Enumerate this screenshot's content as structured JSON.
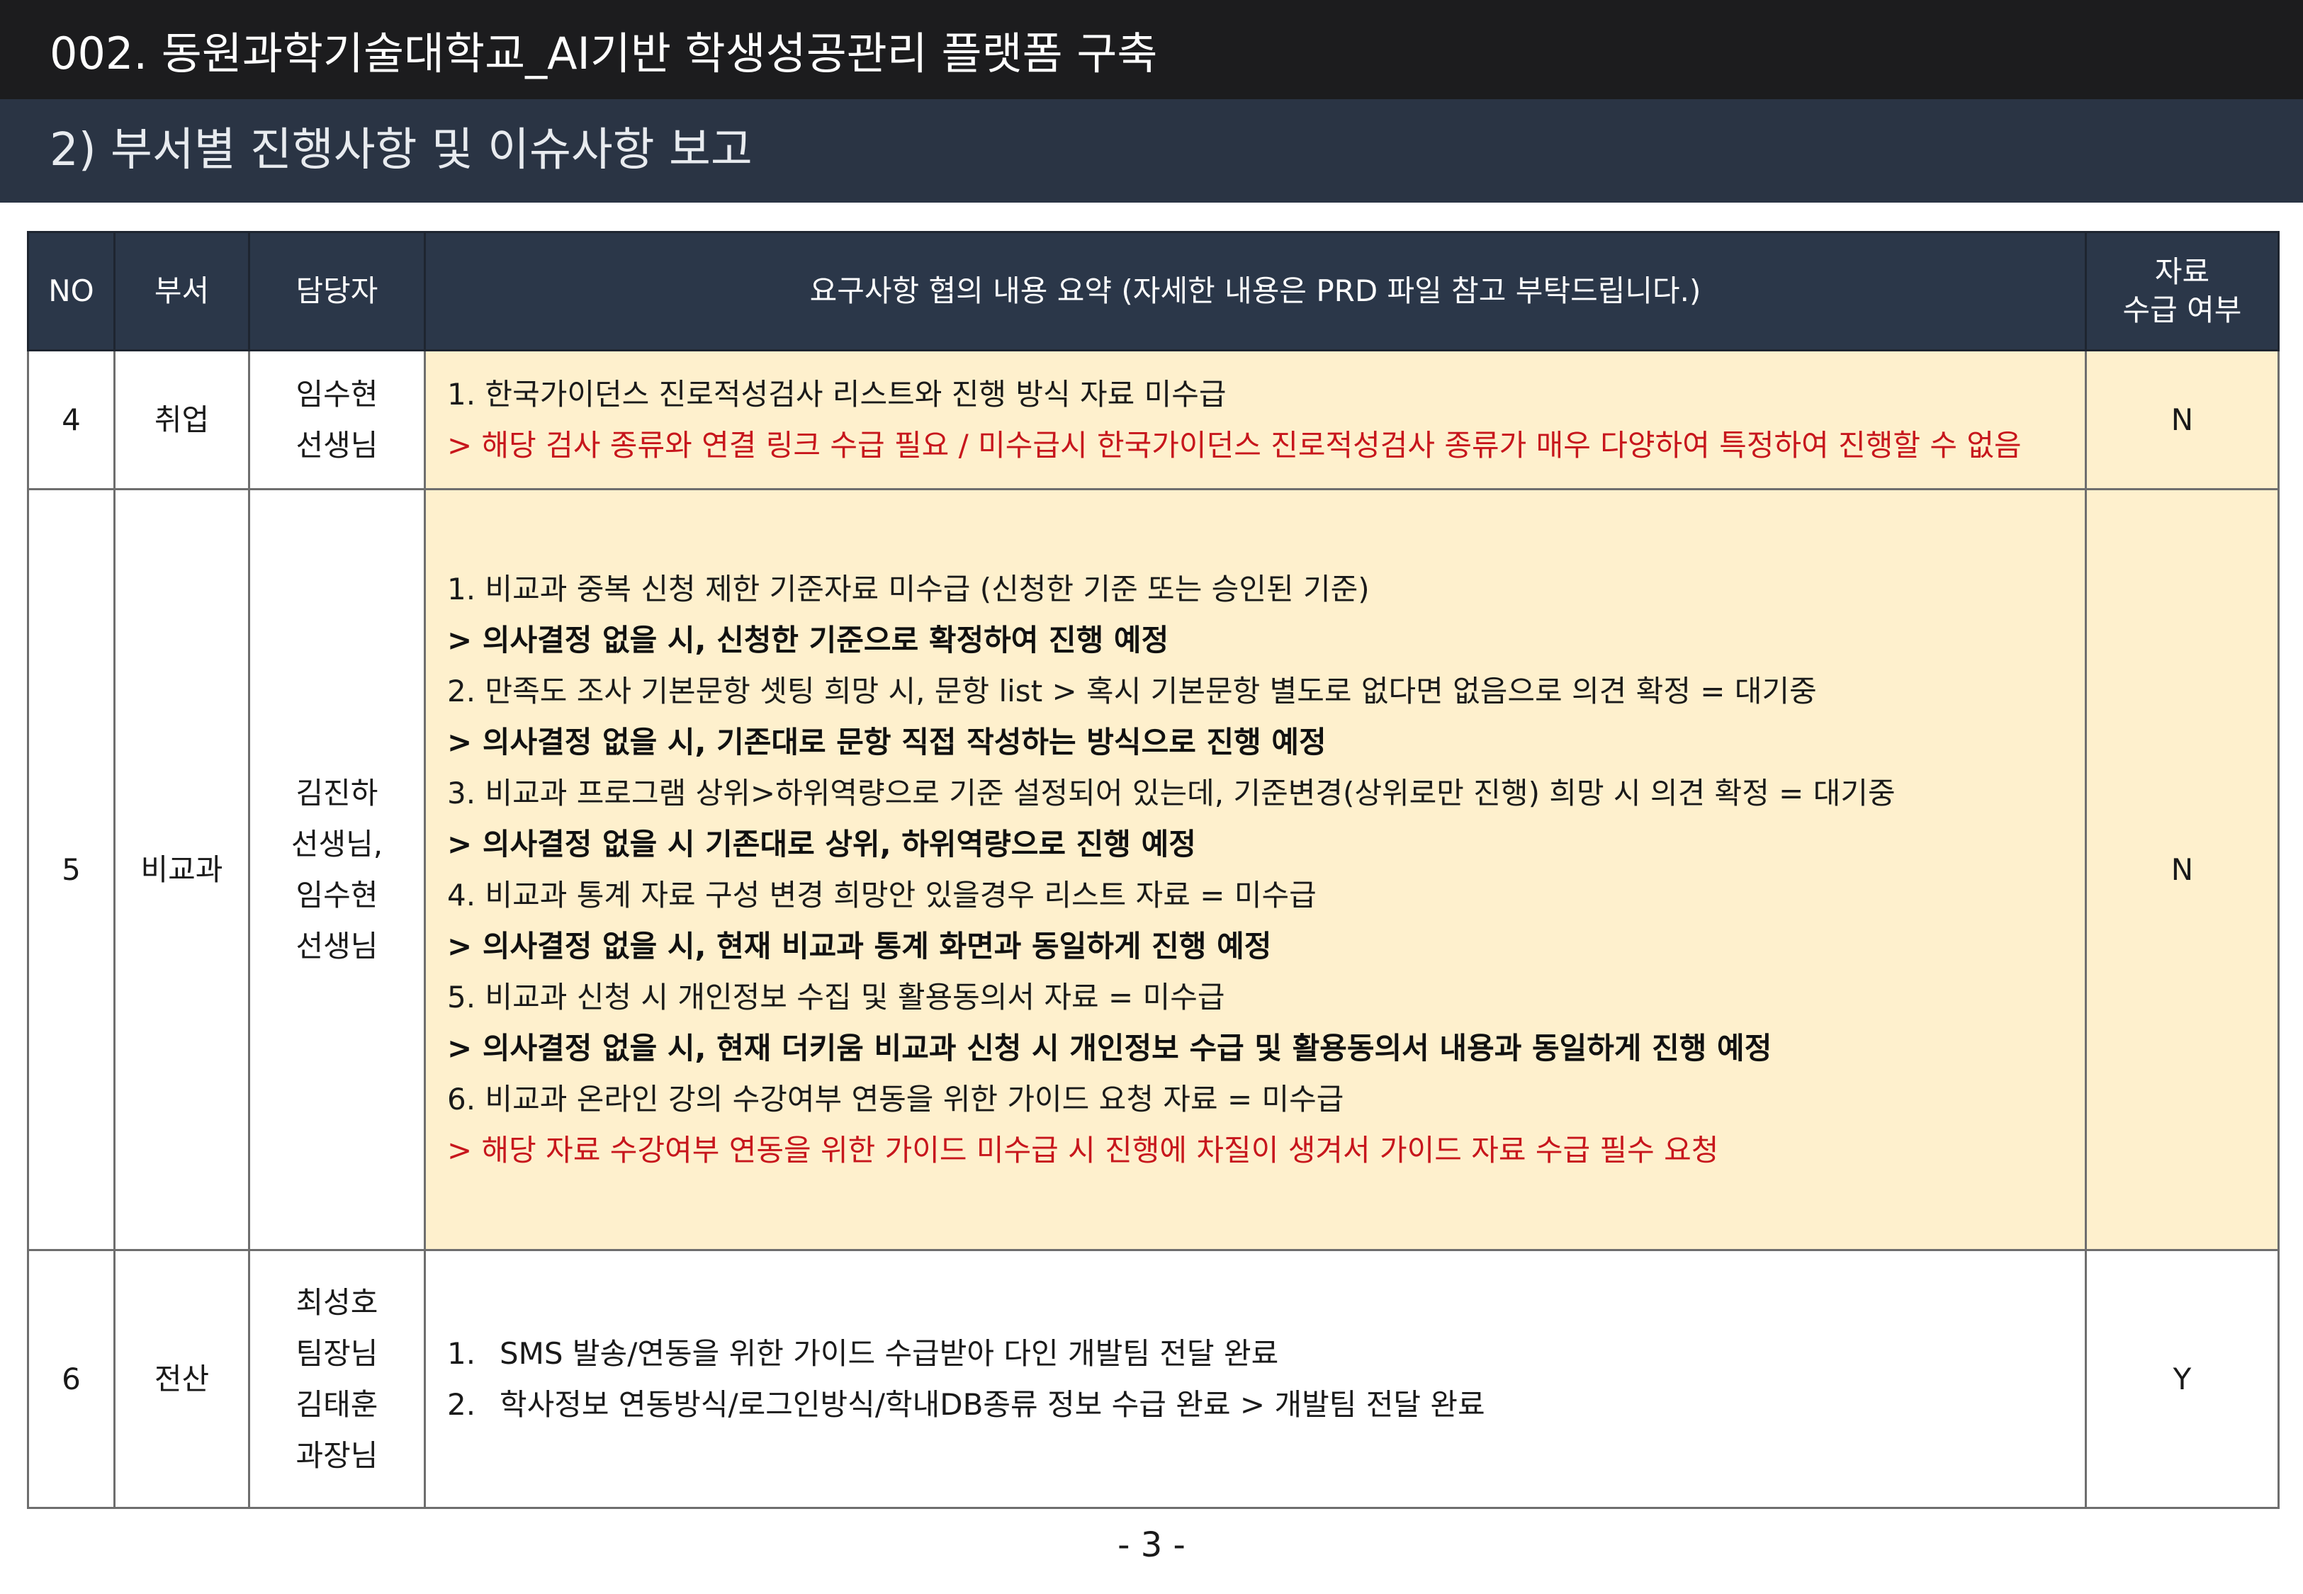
{
  "header": {
    "title": "002. 동원과학기술대학교_AI기반 학생성공관리 플랫폼 구축",
    "subtitle": "2) 부서별 진행사항 및 이슈사항 보고"
  },
  "table": {
    "columns": {
      "no": "NO",
      "department": "부서",
      "owner": "담당자",
      "summary": "요구사항 협의 내용 요약 (자세한 내용은 PRD 파일 참고 부탁드립니다.)",
      "status_line1": "자료",
      "status_line2": "수급 여부"
    },
    "rows": [
      {
        "no": "4",
        "department": "취업",
        "owner": [
          "임수현",
          "선생님"
        ],
        "lines": [
          {
            "text": "1. 한국가이던스 진로적성검사 리스트와 진행 방식 자료 미수급",
            "style": "normal"
          },
          {
            "text": "> 해당 검사 종류와 연결 링크 수급 필요 / 미수급시 한국가이던스 진로적성검사 종류가 매우 다양하여 특정하여 진행할 수 없음",
            "style": "alert"
          }
        ],
        "status": "N"
      },
      {
        "no": "5",
        "department": "비교과",
        "owner": [
          "김진하",
          "선생님,",
          "임수현",
          "선생님"
        ],
        "lines": [
          {
            "text": "1. 비교과 중복 신청 제한 기준자료 미수급 (신청한 기준 또는 승인된 기준)",
            "style": "normal"
          },
          {
            "text": "> 의사결정 없을 시, 신청한 기준으로 확정하여 진행 예정",
            "style": "emph"
          },
          {
            "text": "2. 만족도 조사 기본문항 셋팅 희망 시, 문항 list > 혹시 기본문항 별도로 없다면 없음으로 의견 확정 = 대기중",
            "style": "normal"
          },
          {
            "text": "> 의사결정 없을 시, 기존대로 문항 직접 작성하는 방식으로 진행 예정",
            "style": "emph"
          },
          {
            "text": "3. 비교과 프로그램 상위>하위역량으로 기준 설정되어 있는데, 기준변경(상위로만 진행) 희망 시 의견 확정 = 대기중",
            "style": "normal"
          },
          {
            "text": "> 의사결정 없을 시 기존대로 상위, 하위역량으로 진행 예정",
            "style": "emph"
          },
          {
            "text": "4. 비교과 통계 자료 구성 변경 희망안 있을경우 리스트 자료 = 미수급",
            "style": "normal"
          },
          {
            "text": "> 의사결정 없을 시, 현재 비교과 통계 화면과 동일하게 진행 예정",
            "style": "emph"
          },
          {
            "text": "5. 비교과 신청 시 개인정보 수집 및 활용동의서 자료 = 미수급",
            "style": "normal"
          },
          {
            "text": "> 의사결정 없을 시, 현재 더키움 비교과 신청 시 개인정보 수급 및 활용동의서 내용과 동일하게 진행 예정",
            "style": "emph"
          },
          {
            "text": "6. 비교과 온라인 강의 수강여부 연동을 위한 가이드 요청 자료 = 미수급",
            "style": "normal"
          },
          {
            "text": "> 해당 자료 수강여부 연동을 위한 가이드 미수급 시 진행에 차질이 생겨서 가이드 자료 수급 필수 요청",
            "style": "alert"
          }
        ],
        "status": "N"
      },
      {
        "no": "6",
        "department": "전산",
        "owner": [
          "최성호",
          "팀장님",
          "김태훈",
          "과장님"
        ],
        "numbered_lines": [
          {
            "num": "1.",
            "text": "SMS 발송/연동을 위한 가이드 수급받아 다인 개발팀 전달 완료"
          },
          {
            "num": "2.",
            "text": "학사정보 연동방식/로그인방식/학내DB종류 정보 수급 완료 > 개발팀 전달 완료"
          }
        ],
        "status": "Y"
      }
    ]
  },
  "footer": {
    "page_number": "- 3 -"
  },
  "colors": {
    "title_bar": "#1c1c1e",
    "subtitle_bar": "#2a3444",
    "table_header": "#2b3749",
    "highlight_row": "#fef0cd",
    "alert_text": "#c7161c"
  }
}
